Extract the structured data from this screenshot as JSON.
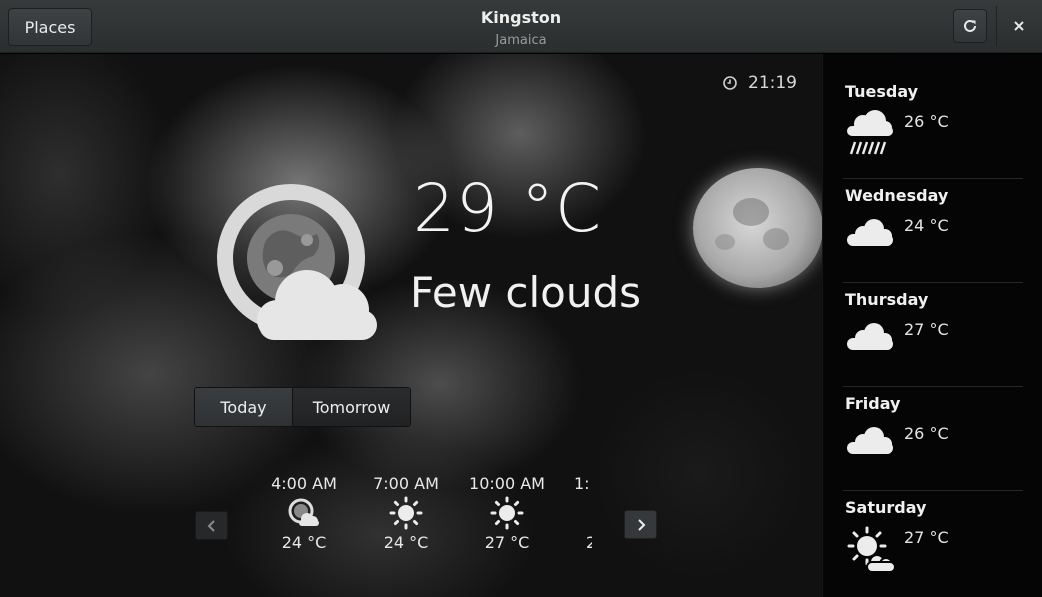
{
  "header": {
    "places_label": "Places",
    "title": "Kingston",
    "subtitle": "Jamaica",
    "refresh_icon": "refresh-icon",
    "close_icon": "close-icon"
  },
  "current": {
    "time": "21:19",
    "temperature": "29 °C",
    "summary": "Few clouds",
    "icon": "few-clouds-night-icon"
  },
  "segmented": {
    "today": "Today",
    "tomorrow": "Tomorrow",
    "selected": "Today"
  },
  "hourly": [
    {
      "time": "4:00 AM",
      "temp": "24 °C",
      "icon": "few-clouds-night-icon"
    },
    {
      "time": "7:00 AM",
      "temp": "24 °C",
      "icon": "clear-icon"
    },
    {
      "time": "10:00 AM",
      "temp": "27 °C",
      "icon": "clear-icon"
    },
    {
      "time": "1:",
      "temp": "2",
      "icon": ""
    }
  ],
  "forecast": [
    {
      "day": "Tuesday",
      "temp": "26 °C",
      "icon": "showers-icon"
    },
    {
      "day": "Wednesday",
      "temp": "24 °C",
      "icon": "overcast-icon"
    },
    {
      "day": "Thursday",
      "temp": "27 °C",
      "icon": "overcast-icon"
    },
    {
      "day": "Friday",
      "temp": "26 °C",
      "icon": "overcast-icon"
    },
    {
      "day": "Saturday",
      "temp": "27 °C",
      "icon": "few-clouds-day-icon"
    }
  ],
  "colors": {
    "header_bg": "#2f3233",
    "sidebar_bg": "#050505",
    "text": "#eeeeec"
  }
}
